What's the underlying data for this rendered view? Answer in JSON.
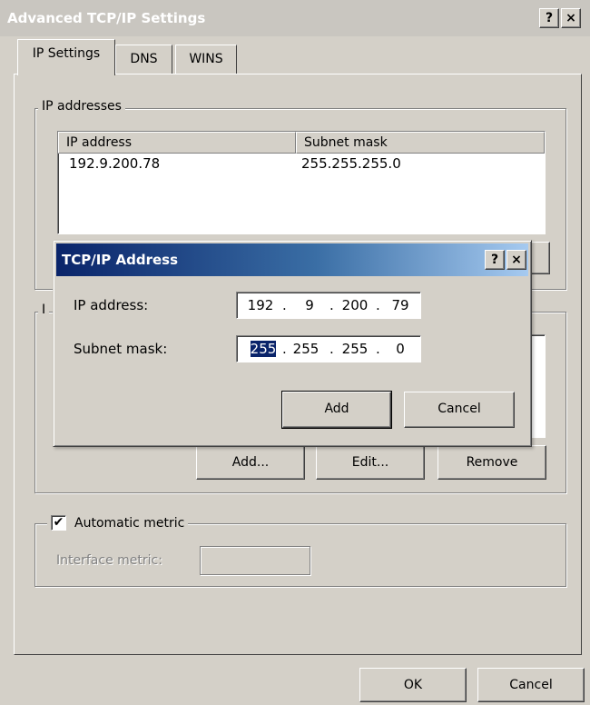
{
  "window": {
    "title": "Advanced TCP/IP Settings",
    "help_glyph": "?",
    "close_glyph": "×"
  },
  "tabs": [
    {
      "label": "IP Settings",
      "active": true
    },
    {
      "label": "DNS",
      "active": false
    },
    {
      "label": "WINS",
      "active": false
    }
  ],
  "ip_addresses": {
    "legend": "IP addresses",
    "columns": [
      "IP address",
      "Subnet mask"
    ],
    "rows": [
      {
        "ip": "192.9.200.78",
        "mask": "255.255.255.0"
      }
    ]
  },
  "gateways": {
    "legend_partial": "I",
    "buttons": {
      "add": "Add...",
      "edit": "Edit...",
      "remove": "Remove"
    }
  },
  "metric": {
    "checkbox_label": "Automatic metric",
    "checked": true,
    "check_glyph": "✔",
    "interface_metric_label": "Interface metric:",
    "interface_metric_value": ""
  },
  "footer": {
    "ok": "OK",
    "cancel": "Cancel"
  },
  "dialog": {
    "title": "TCP/IP Address",
    "help_glyph": "?",
    "close_glyph": "×",
    "ip_label": "IP address:",
    "ip_octets": [
      "192",
      "9",
      "200",
      "79"
    ],
    "mask_label": "Subnet mask:",
    "mask_octets": [
      "255",
      "255",
      "255",
      "0"
    ],
    "selected_octet": "255",
    "dot": ".",
    "add_button": "Add",
    "cancel_button": "Cancel"
  },
  "colors": {
    "dialog_title_start": "#0a246a",
    "dialog_title_end": "#a6caf0",
    "face": "#d4d0c8",
    "selection": "#0a246a"
  }
}
